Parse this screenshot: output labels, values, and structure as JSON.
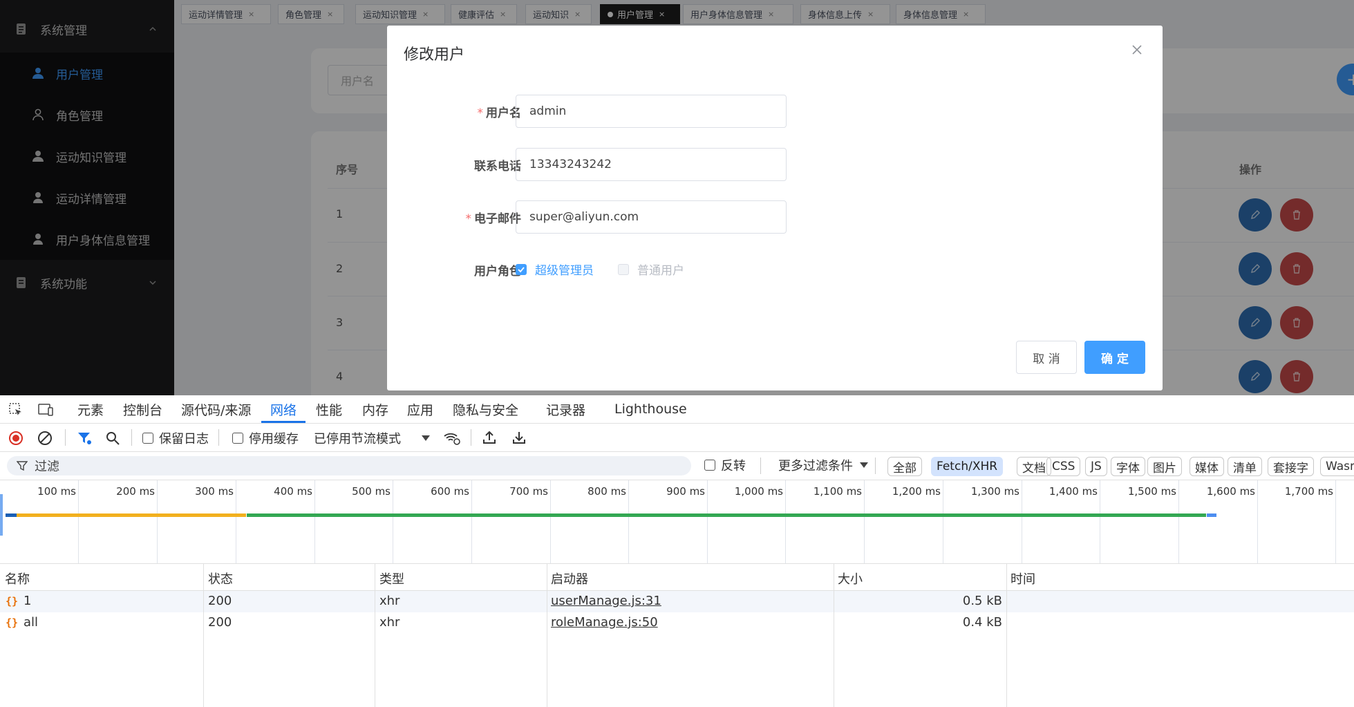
{
  "sidebar": {
    "group1": "系统管理",
    "items": [
      {
        "label": "用户管理",
        "active": true
      },
      {
        "label": "角色管理",
        "active": false
      },
      {
        "label": "运动知识管理",
        "active": false
      },
      {
        "label": "运动详情管理",
        "active": false
      },
      {
        "label": "用户身体信息管理",
        "active": false
      }
    ],
    "group2": "系统功能"
  },
  "tabs": [
    {
      "label": "运动详情管理",
      "active": false
    },
    {
      "label": "角色管理",
      "active": false
    },
    {
      "label": "运动知识管理",
      "active": false
    },
    {
      "label": "健康评估",
      "active": false
    },
    {
      "label": "运动知识",
      "active": false
    },
    {
      "label": "用户管理",
      "active": true
    },
    {
      "label": "用户身体信息管理",
      "active": false
    },
    {
      "label": "身体信息上传",
      "active": false
    },
    {
      "label": "身体信息管理",
      "active": false
    }
  ],
  "tab_close": "×",
  "background": {
    "search_placeholder": "用户名",
    "add_icon": "+",
    "col_index": "序号",
    "col_actions": "操作",
    "rows": [
      "1",
      "2",
      "3",
      "4"
    ]
  },
  "modal": {
    "title": "修改用户",
    "username_label": "用户名",
    "username_value": "admin",
    "phone_label": "联系电话",
    "phone_value": "13343243242",
    "email_label": "电子邮件",
    "email_value": "super@aliyun.com",
    "role_label": "用户角色",
    "roles": [
      {
        "label": "超级管理员",
        "checked": true
      },
      {
        "label": "普通用户",
        "checked": false
      }
    ],
    "required_mark": "*",
    "cancel": "取 消",
    "confirm": "确 定"
  },
  "devtools": {
    "tabs": [
      "元素",
      "控制台",
      "源代码/来源",
      "网络",
      "性能",
      "内存",
      "应用",
      "隐私与安全",
      "记录器",
      "Lighthouse"
    ],
    "active_tab": "网络",
    "preserve_log": "保留日志",
    "disable_cache": "停用缓存",
    "throttle": "已停用节流模式",
    "filter_placeholder": "过滤",
    "invert": "反转",
    "more_filters": "更多过滤条件",
    "type_chips": [
      {
        "label": "全部",
        "selected": false
      },
      {
        "label": "Fetch/XHR",
        "selected": true
      },
      {
        "label": "文档",
        "selected": false
      },
      {
        "label": "CSS",
        "selected": false
      },
      {
        "label": "JS",
        "selected": false
      },
      {
        "label": "字体",
        "selected": false
      },
      {
        "label": "图片",
        "selected": false
      },
      {
        "label": "媒体",
        "selected": false
      },
      {
        "label": "清单",
        "selected": false
      },
      {
        "label": "套接字",
        "selected": false
      },
      {
        "label": "Wasm",
        "selected": false
      }
    ],
    "timeline_labels": [
      "100 ms",
      "200 ms",
      "300 ms",
      "400 ms",
      "500 ms",
      "600 ms",
      "700 ms",
      "800 ms",
      "900 ms",
      "1,000 ms",
      "1,100 ms",
      "1,200 ms",
      "1,300 ms",
      "1,400 ms",
      "1,500 ms",
      "1,600 ms",
      "1,700 ms"
    ],
    "columns": [
      "名称",
      "状态",
      "类型",
      "启动器",
      "大小",
      "时间"
    ],
    "requests": [
      {
        "name": "1",
        "status": "200",
        "type": "xhr",
        "initiator": "userManage.js:31",
        "size": "0.5 kB"
      },
      {
        "name": "all",
        "status": "200",
        "type": "xhr",
        "initiator": "roleManage.js:50",
        "size": "0.4 kB"
      }
    ]
  },
  "colors": {
    "accent": "#409eff",
    "devtools_accent": "#1a73e8",
    "required": "#f56c6c"
  }
}
